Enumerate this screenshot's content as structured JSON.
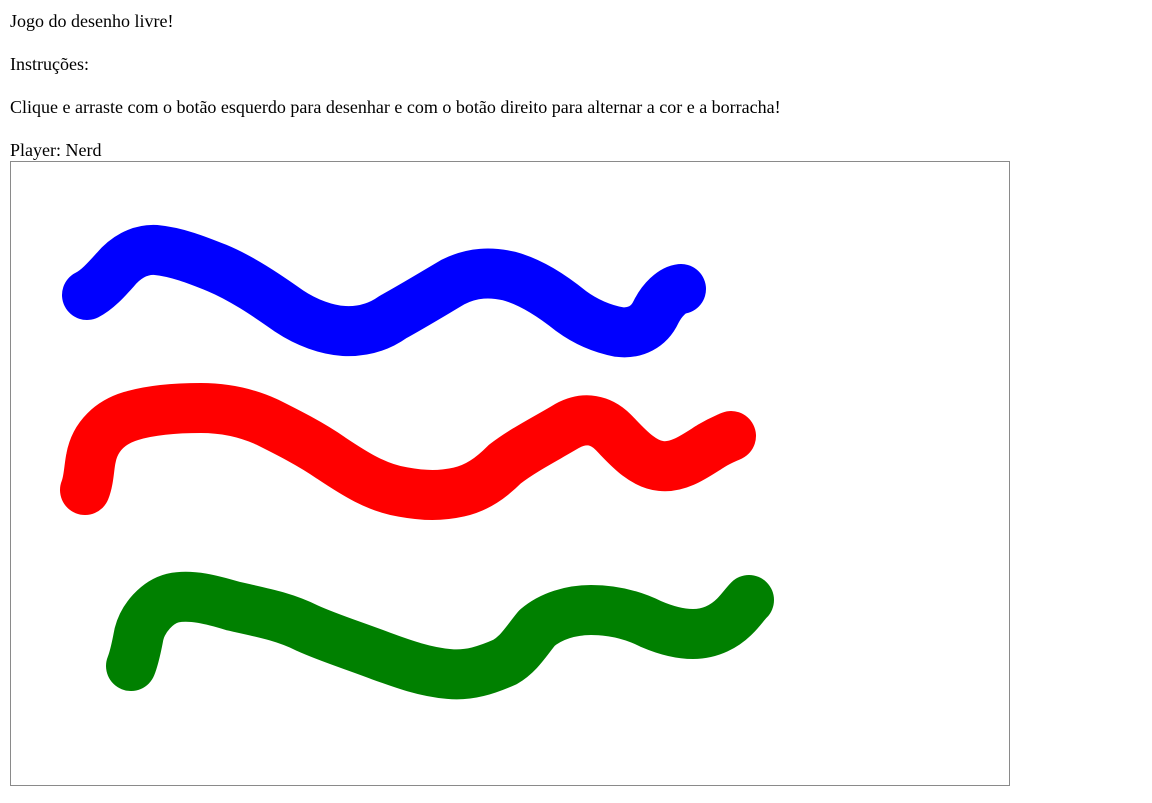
{
  "page": {
    "title": "Jogo do desenho livre!",
    "instructions_heading": "Instruções:",
    "instructions_text": "Clique e arraste com o botão esquerdo para desenhar e com o botão direito para alternar a cor e a borracha!",
    "player_label": "Player: Nerd"
  },
  "canvas": {
    "background_color": "#ffffff",
    "strokes": [
      {
        "color": "#0000ff",
        "name": "blue-stroke"
      },
      {
        "color": "#ff0000",
        "name": "red-stroke"
      },
      {
        "color": "#008000",
        "name": "green-stroke"
      }
    ]
  }
}
